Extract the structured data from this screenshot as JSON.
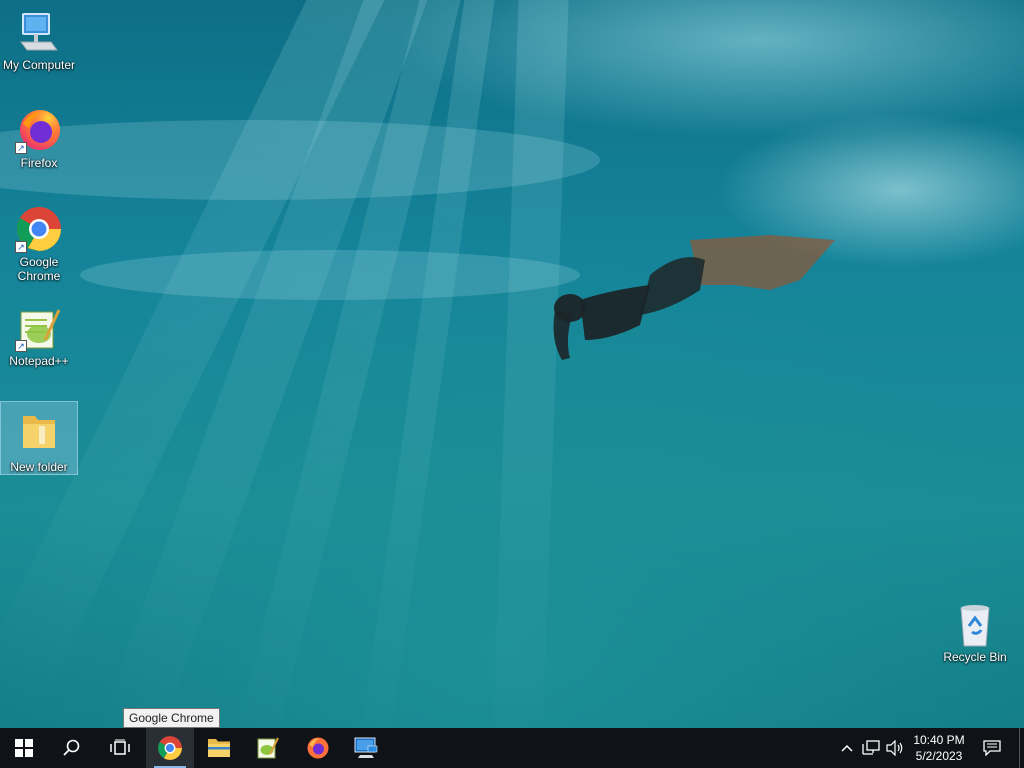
{
  "desktop": {
    "icons": [
      {
        "label": "My Computer",
        "icon": "computer-icon"
      },
      {
        "label": "Firefox",
        "icon": "firefox-icon"
      },
      {
        "label": "Google Chrome",
        "icon": "chrome-icon"
      },
      {
        "label": "Notepad++",
        "icon": "notepad-plus-plus-icon"
      },
      {
        "label": "New folder",
        "icon": "folder-icon"
      },
      {
        "label": "Recycle Bin",
        "icon": "recycle-bin-icon"
      }
    ]
  },
  "tooltip": {
    "text": "Google Chrome"
  },
  "taskbar": {
    "start": "windows-logo-icon",
    "search": "search-icon",
    "task_view": "task-view-icon",
    "pinned": [
      {
        "name": "Google Chrome",
        "icon": "chrome-icon",
        "active": true
      },
      {
        "name": "File Explorer",
        "icon": "folder-icon"
      },
      {
        "name": "Notepad++",
        "icon": "notepad-plus-plus-icon"
      },
      {
        "name": "Firefox",
        "icon": "firefox-icon"
      },
      {
        "name": "Remote Desktop",
        "icon": "remote-desktop-icon"
      }
    ],
    "tray": {
      "show_hidden": "chevron-up-icon",
      "network": "network-icon",
      "volume": "volume-icon",
      "notifications": "notification-icon"
    },
    "clock": {
      "time": "10:40 PM",
      "date": "5/2/2023"
    }
  },
  "colors": {
    "taskbar": "#0f1318",
    "selection": "#a0d2eb",
    "water": "#15849a"
  }
}
